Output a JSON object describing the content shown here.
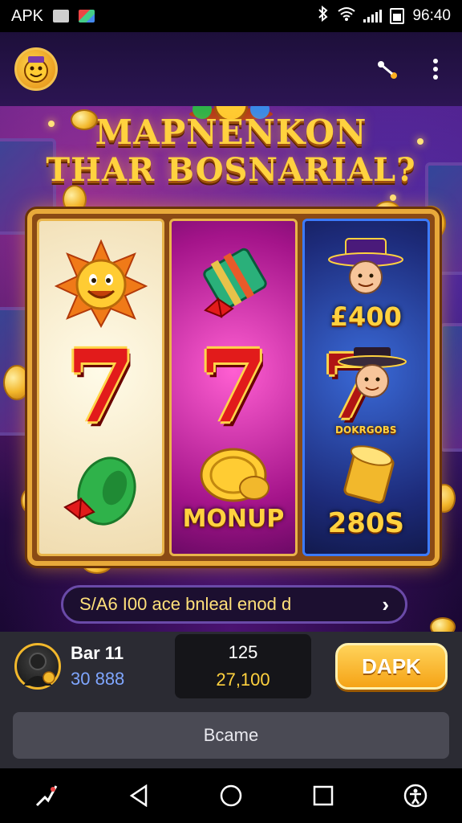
{
  "status_bar": {
    "app_label": "APK",
    "time": "96:40"
  },
  "app_bar": {
    "avatar_icon": "mascot-avatar-icon",
    "share_icon": "share-icon",
    "menu_icon": "more-vertical-icon"
  },
  "game": {
    "title_line1": "MAPNENKON",
    "title_line2": "THAR BOSNARIAL?",
    "reels": [
      {
        "symbols": [
          "sun-face",
          "seven",
          "green-ribbon-cylinder"
        ],
        "labels": [
          "",
          "7",
          ""
        ]
      },
      {
        "symbols": [
          "gift-box",
          "seven",
          "gold-coins"
        ],
        "labels": [
          "",
          "7",
          "MONUP"
        ]
      },
      {
        "symbols": [
          "hat-man",
          "seven-with-man",
          "coin-stack"
        ],
        "labels": [
          "£400",
          "DOKRGOBS",
          "280S"
        ]
      }
    ],
    "info_bar_text": "S/A6 I00 ace bnleal enod d",
    "colors": {
      "gold": "#ffd23f",
      "frame": "#e8a93a",
      "accent_purple": "#4a1a7a"
    }
  },
  "player": {
    "name": "Bar 11",
    "balance": "30 888",
    "bet_top": "125",
    "bet_bottom": "27,100",
    "action_label": "DAPK"
  },
  "bottom_button_label": "Bcame",
  "nav": {
    "items": [
      "assist-icon",
      "back-icon",
      "home-icon",
      "recents-icon",
      "accessibility-icon"
    ]
  }
}
